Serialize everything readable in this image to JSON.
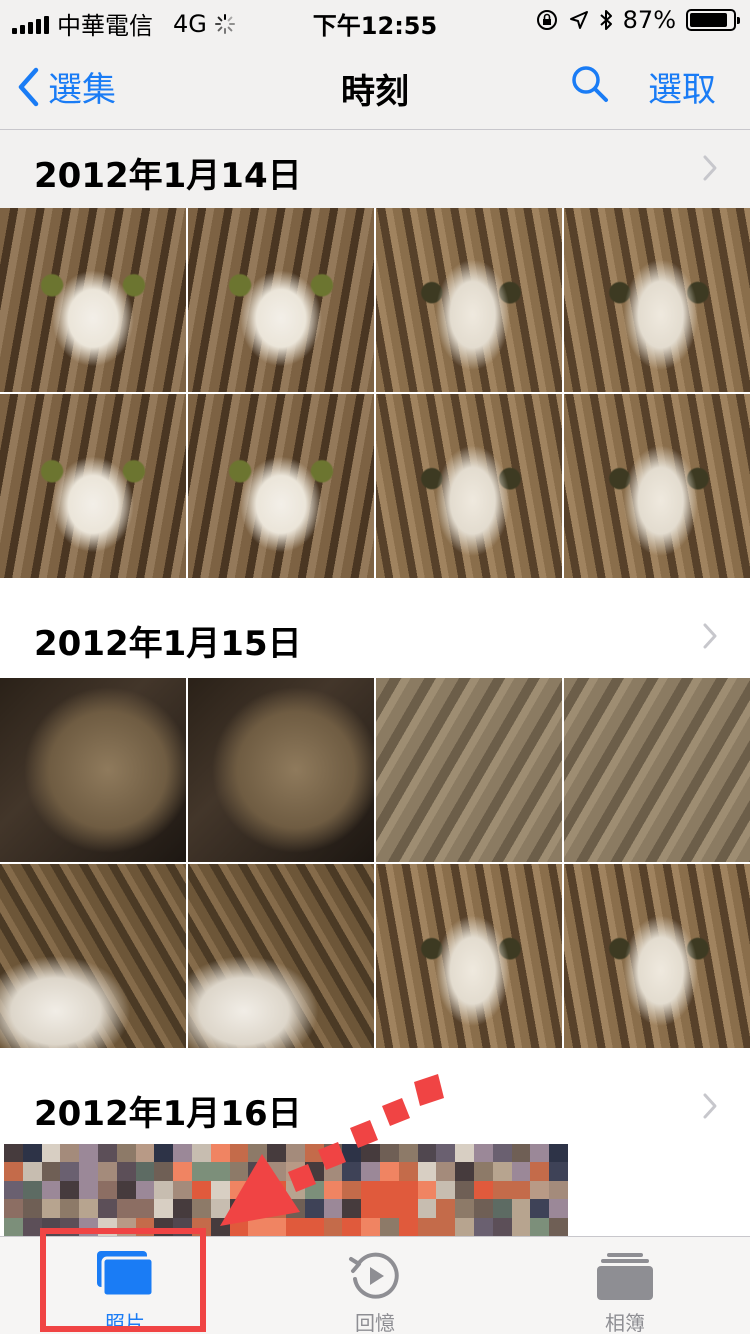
{
  "status_bar": {
    "carrier": "中華電信",
    "network": "4G",
    "time": "下午12:55",
    "battery": "87%",
    "battery_level": 0.87
  },
  "nav": {
    "back_label": "選集",
    "title": "時刻",
    "select_label": "選取"
  },
  "sections": [
    {
      "date": "2012年1月14日"
    },
    {
      "date": "2012年1月15日"
    },
    {
      "date": "2012年1月16日"
    }
  ],
  "tabs": [
    {
      "label": "照片",
      "icon": "photos-icon",
      "active": true
    },
    {
      "label": "回憶",
      "icon": "memories-icon",
      "active": false
    },
    {
      "label": "相簿",
      "icon": "albums-icon",
      "active": false
    }
  ],
  "colors": {
    "accent": "#1a7cf5",
    "annotation": "#f04444",
    "bar_background": "#f2f1f0"
  }
}
